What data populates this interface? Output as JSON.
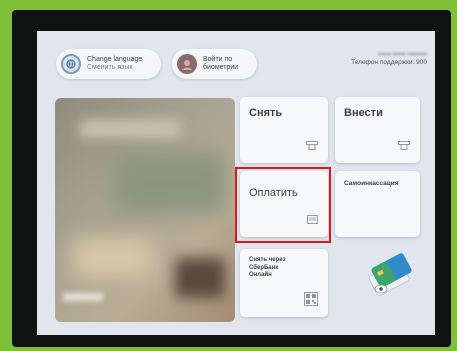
{
  "topbar": {
    "change_language_title": "Change language",
    "change_language_subtitle": "Сменить язык",
    "biometrics_line1": "Войти по",
    "biometrics_line2": "биометрии",
    "support_label": "Телефон поддержки: 900"
  },
  "tiles": {
    "withdraw_label": "Снять",
    "deposit_label": "Внести",
    "pay_label": "Оплатить",
    "self_collection_label": "Самоинкассация",
    "sberbank_online_line1": "Снять через",
    "sberbank_online_line2": "СберБанк",
    "sberbank_online_line3": "Онлайн"
  },
  "colors": {
    "device_frame": "#7fbf3a",
    "bezel": "#101211",
    "screen_background": "#e1e6ee",
    "tile_background": "#f7f8fa",
    "highlight": "#d7191f"
  },
  "icons": {
    "change_language": "globe-icon",
    "biometrics": "face-icon",
    "withdraw": "cash-out-icon",
    "deposit": "cash-in-icon",
    "pay": "receipt-icon",
    "sberbank_online": "qr-code-icon",
    "cards": "bank-cards-icon"
  }
}
